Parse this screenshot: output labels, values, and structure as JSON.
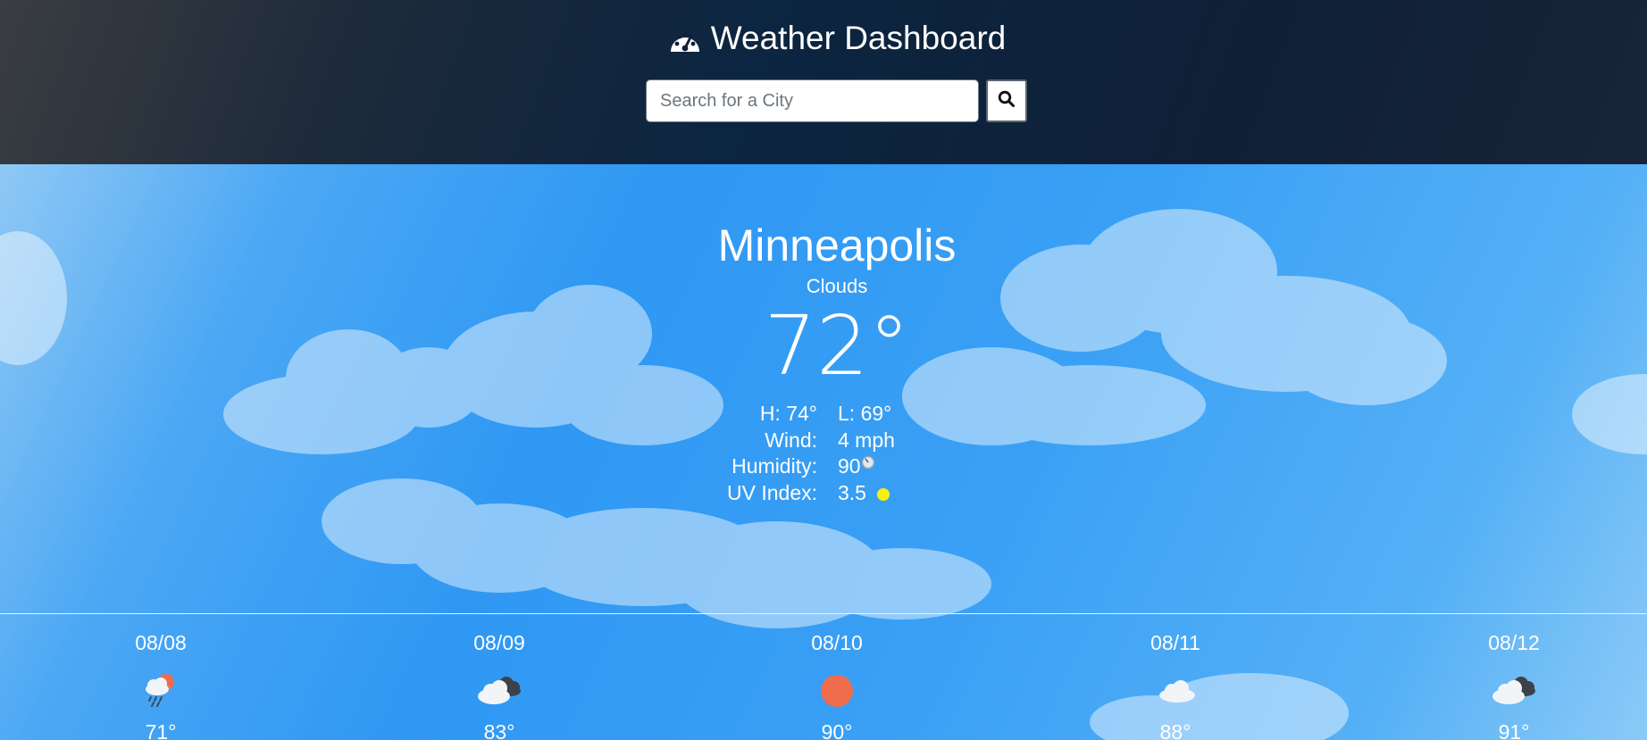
{
  "header": {
    "title": "Weather Dashboard",
    "title_icon": "tachometer-icon",
    "search_placeholder": "Search for a City",
    "search_button_icon": "search-icon"
  },
  "current": {
    "city": "Minneapolis",
    "condition": "Clouds",
    "temperature": "72°",
    "high_label": "H: 74°",
    "low_label": "L: 69°",
    "wind_label": "Wind:",
    "wind_value": "4 mph",
    "humidity_label": "Humidity:",
    "humidity_value": "90",
    "humidity_icon": "humidity-gauge-icon",
    "uv_label": "UV Index:",
    "uv_value": "3.5",
    "uv_color": "#f6f20a"
  },
  "forecast": [
    {
      "date": "08/08",
      "icon": "rain-sun-icon",
      "temp": "71°"
    },
    {
      "date": "08/09",
      "icon": "cloudy-icon",
      "temp": "83°"
    },
    {
      "date": "08/10",
      "icon": "sun-icon",
      "temp": "90°"
    },
    {
      "date": "08/11",
      "icon": "cloud-icon",
      "temp": "88°"
    },
    {
      "date": "08/12",
      "icon": "cloudy-icon",
      "temp": "91°"
    }
  ],
  "colors": {
    "sky": "#2f98f3",
    "header": "#0c2540",
    "sun": "#ef6c4c"
  }
}
